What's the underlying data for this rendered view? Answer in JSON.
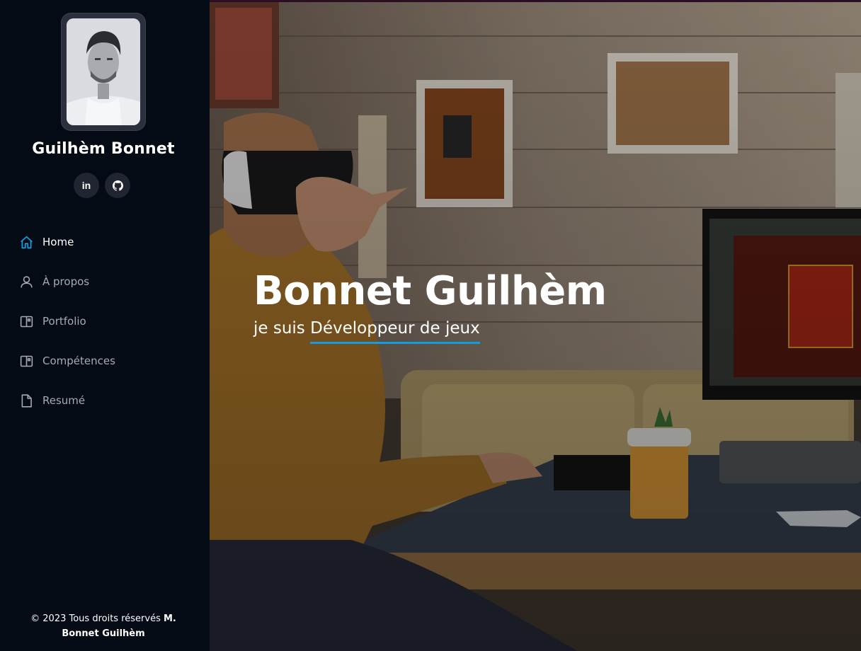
{
  "profile": {
    "name": "Guilhèm Bonnet",
    "social": [
      {
        "label": "in",
        "icon": "linkedin-icon"
      },
      {
        "label": "",
        "icon": "github-icon"
      }
    ]
  },
  "nav": [
    {
      "label": "Home",
      "icon": "home-icon",
      "active": true
    },
    {
      "label": "À propos",
      "icon": "person-icon",
      "active": false
    },
    {
      "label": "Portfolio",
      "icon": "layout-icon",
      "active": false
    },
    {
      "label": "Compétences",
      "icon": "layout-icon",
      "active": false
    },
    {
      "label": "Resumé",
      "icon": "file-icon",
      "active": false
    }
  ],
  "footer": {
    "text": "© 2023 Tous droits réservés ",
    "owner": "M. Bonnet Guilhèm"
  },
  "hero": {
    "title": "Bonnet Guilhèm",
    "subtitle_prefix": "je suis ",
    "subtitle_typed": "Développeur de jeux"
  },
  "colors": {
    "sidebar_bg": "#040b14",
    "accent": "#149ddd",
    "nav_inactive": "#a8a9b4"
  }
}
